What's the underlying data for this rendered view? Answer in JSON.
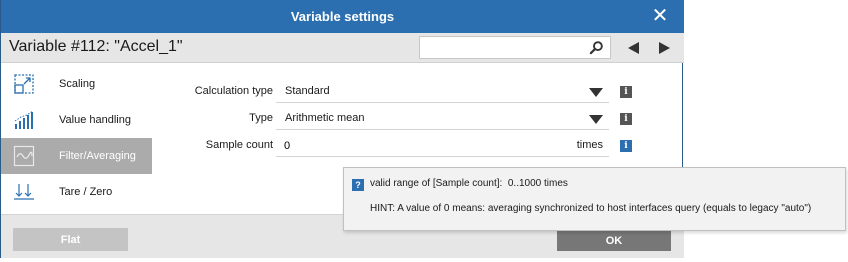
{
  "window": {
    "title": "Variable settings"
  },
  "header": {
    "variable_title": "Variable #112: \"Accel_1\"",
    "search": {
      "value": "",
      "placeholder": ""
    }
  },
  "sidebar": {
    "items": [
      {
        "label": "Scaling",
        "icon": "scaling-icon",
        "active": false
      },
      {
        "label": "Value handling",
        "icon": "value-handling-icon",
        "active": false
      },
      {
        "label": "Filter/Averaging",
        "icon": "filter-wave-icon",
        "active": true
      },
      {
        "label": "Tare / Zero",
        "icon": "tare-zero-icon",
        "active": false
      }
    ]
  },
  "form": {
    "calculation_type": {
      "label": "Calculation type",
      "value": "Standard"
    },
    "type": {
      "label": "Type",
      "value": "Arithmetic mean"
    },
    "sample_count": {
      "label": "Sample count",
      "value": "0",
      "unit": "times"
    }
  },
  "tooltip": {
    "line1": "valid range of [Sample count]:  0..1000 times",
    "line2": "HINT: A value of 0 means: averaging synchronized to host interfaces query (equals to legacy \"auto\")"
  },
  "footer": {
    "flat_label": "Flat",
    "ok_label": "OK"
  },
  "colors": {
    "title_bar": "#2b6fb0",
    "active_sidebar": "#ababab",
    "info_dark": "#555555",
    "info_active": "#2b6fb0",
    "ok_button": "#777777",
    "flat_button": "#c4c4c4"
  }
}
